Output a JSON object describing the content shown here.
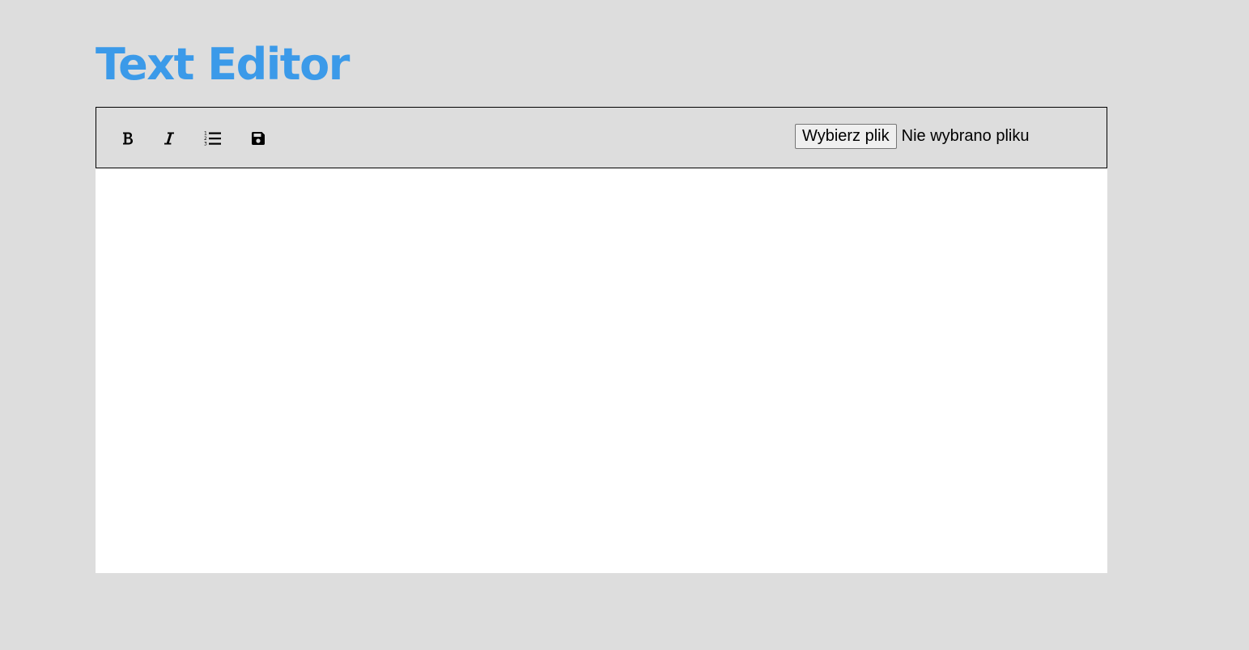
{
  "header": {
    "title": "Text Editor",
    "title_color": "#3b9ae9"
  },
  "toolbar": {
    "buttons": [
      {
        "name": "bold",
        "icon": "bold-icon"
      },
      {
        "name": "italic",
        "icon": "italic-icon"
      },
      {
        "name": "ordered-list",
        "icon": "ordered-list-icon"
      },
      {
        "name": "save",
        "icon": "floppy-disk-icon"
      }
    ],
    "file_input": {
      "button_label": "Wybierz plik",
      "status_text": "Nie wybrano pliku"
    }
  },
  "editor": {
    "content": ""
  },
  "colors": {
    "background": "#dddddd",
    "editor_background": "#ffffff",
    "accent": "#3b9ae9"
  }
}
